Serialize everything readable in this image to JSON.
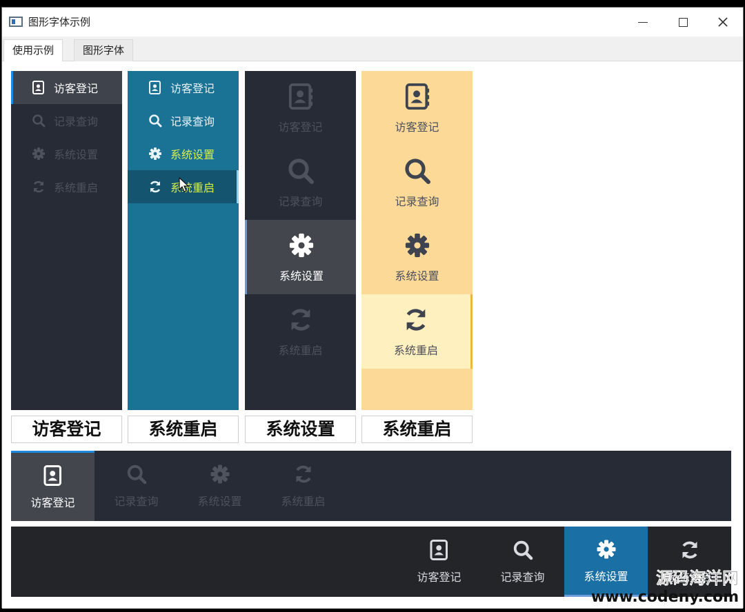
{
  "window": {
    "title": "图形字体示例"
  },
  "tabs": [
    "使用示例",
    "图形字体"
  ],
  "menu": [
    "访客登记",
    "记录查询",
    "系统设置",
    "系统重启"
  ],
  "big_labels": [
    "访客登记",
    "系统重启",
    "系统设置",
    "系统重启"
  ],
  "watermark": {
    "line1": "源码海洋网",
    "line2": "www.codeny.com"
  },
  "colors": {
    "dark_bg": "#262b36",
    "blue_bg": "#1a7295",
    "yellow_bg": "#fdd997",
    "accent_blue": "#1d8ae0",
    "highlight_green": "#d8f04a"
  },
  "icons": [
    "address-book-icon",
    "search-icon",
    "gear-icon",
    "refresh-icon"
  ]
}
